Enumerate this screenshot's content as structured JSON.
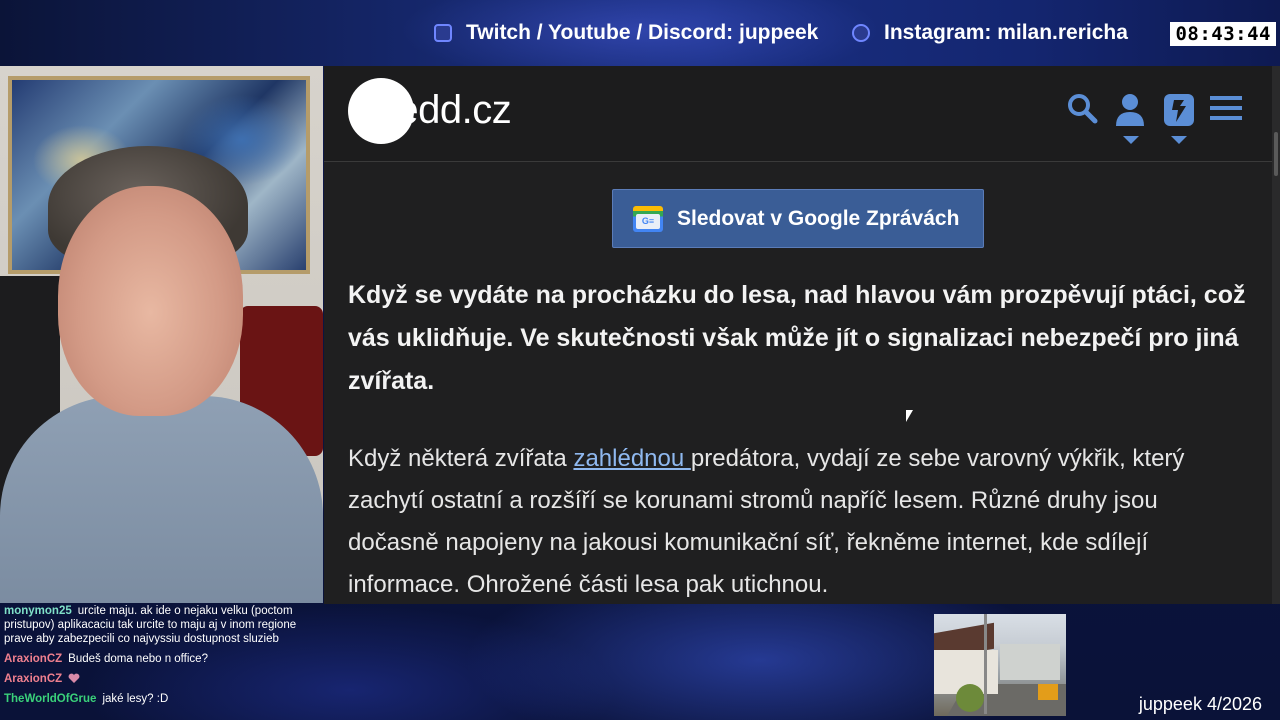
{
  "top_bar": {
    "twitch_label": "Twitch / Youtube / Discord: juppeek",
    "instagram_label": "Instagram: milan.rericha",
    "clock": "08:43:44"
  },
  "site": {
    "logo_text": "Nedd.cz",
    "header_icons": [
      "search-icon",
      "user-icon",
      "theme-icon",
      "menu-icon"
    ],
    "accent_color": "#5b8ed6"
  },
  "google_news_button": {
    "label": "Sledovat v Google Zprávách",
    "icon_text": "G≡"
  },
  "article": {
    "lead": "Když se vydáte na procházku do lesa, nad hlavou vám prozpěvují ptáci, což vás uklidňuje. Ve skutečnosti však může jít o signalizaci nebezpečí pro jiná zvířata.",
    "para_before_link": "Když některá zvířata ",
    "link_text": "zahlédnou ",
    "para_after_link": "predátora, vydají ze sebe varovný výkřik, který zachytí ostatní a rozšíří se korunami stromů napříč lesem. Různé druhy jsou dočasně napojeny na jakousi komunikační síť, řekněme internet, kde sdílejí informace. Ohrožené části lesa pak utichnou."
  },
  "chat": {
    "messages": [
      {
        "user": "monymon25",
        "user_color": "#7fe0c8",
        "text": "urcite maju. ak ide o nejaku velku (poctom pristupov) aplikacaciu tak urcite to maju aj v inom regione prave aby zabezpecili co najvyssiu dostupnost sluzieb"
      },
      {
        "user": "AraxionCZ",
        "user_color": "#f0808f",
        "text": "Budeš doma nebo n office?"
      },
      {
        "user": "AraxionCZ",
        "user_color": "#f0808f",
        "text": ""
      },
      {
        "user": "TheWorldOfGrue",
        "user_color": "#3ad17a",
        "text": "jaké lesy? :D"
      }
    ]
  },
  "footer": {
    "tag": "juppeek 4/2026"
  }
}
